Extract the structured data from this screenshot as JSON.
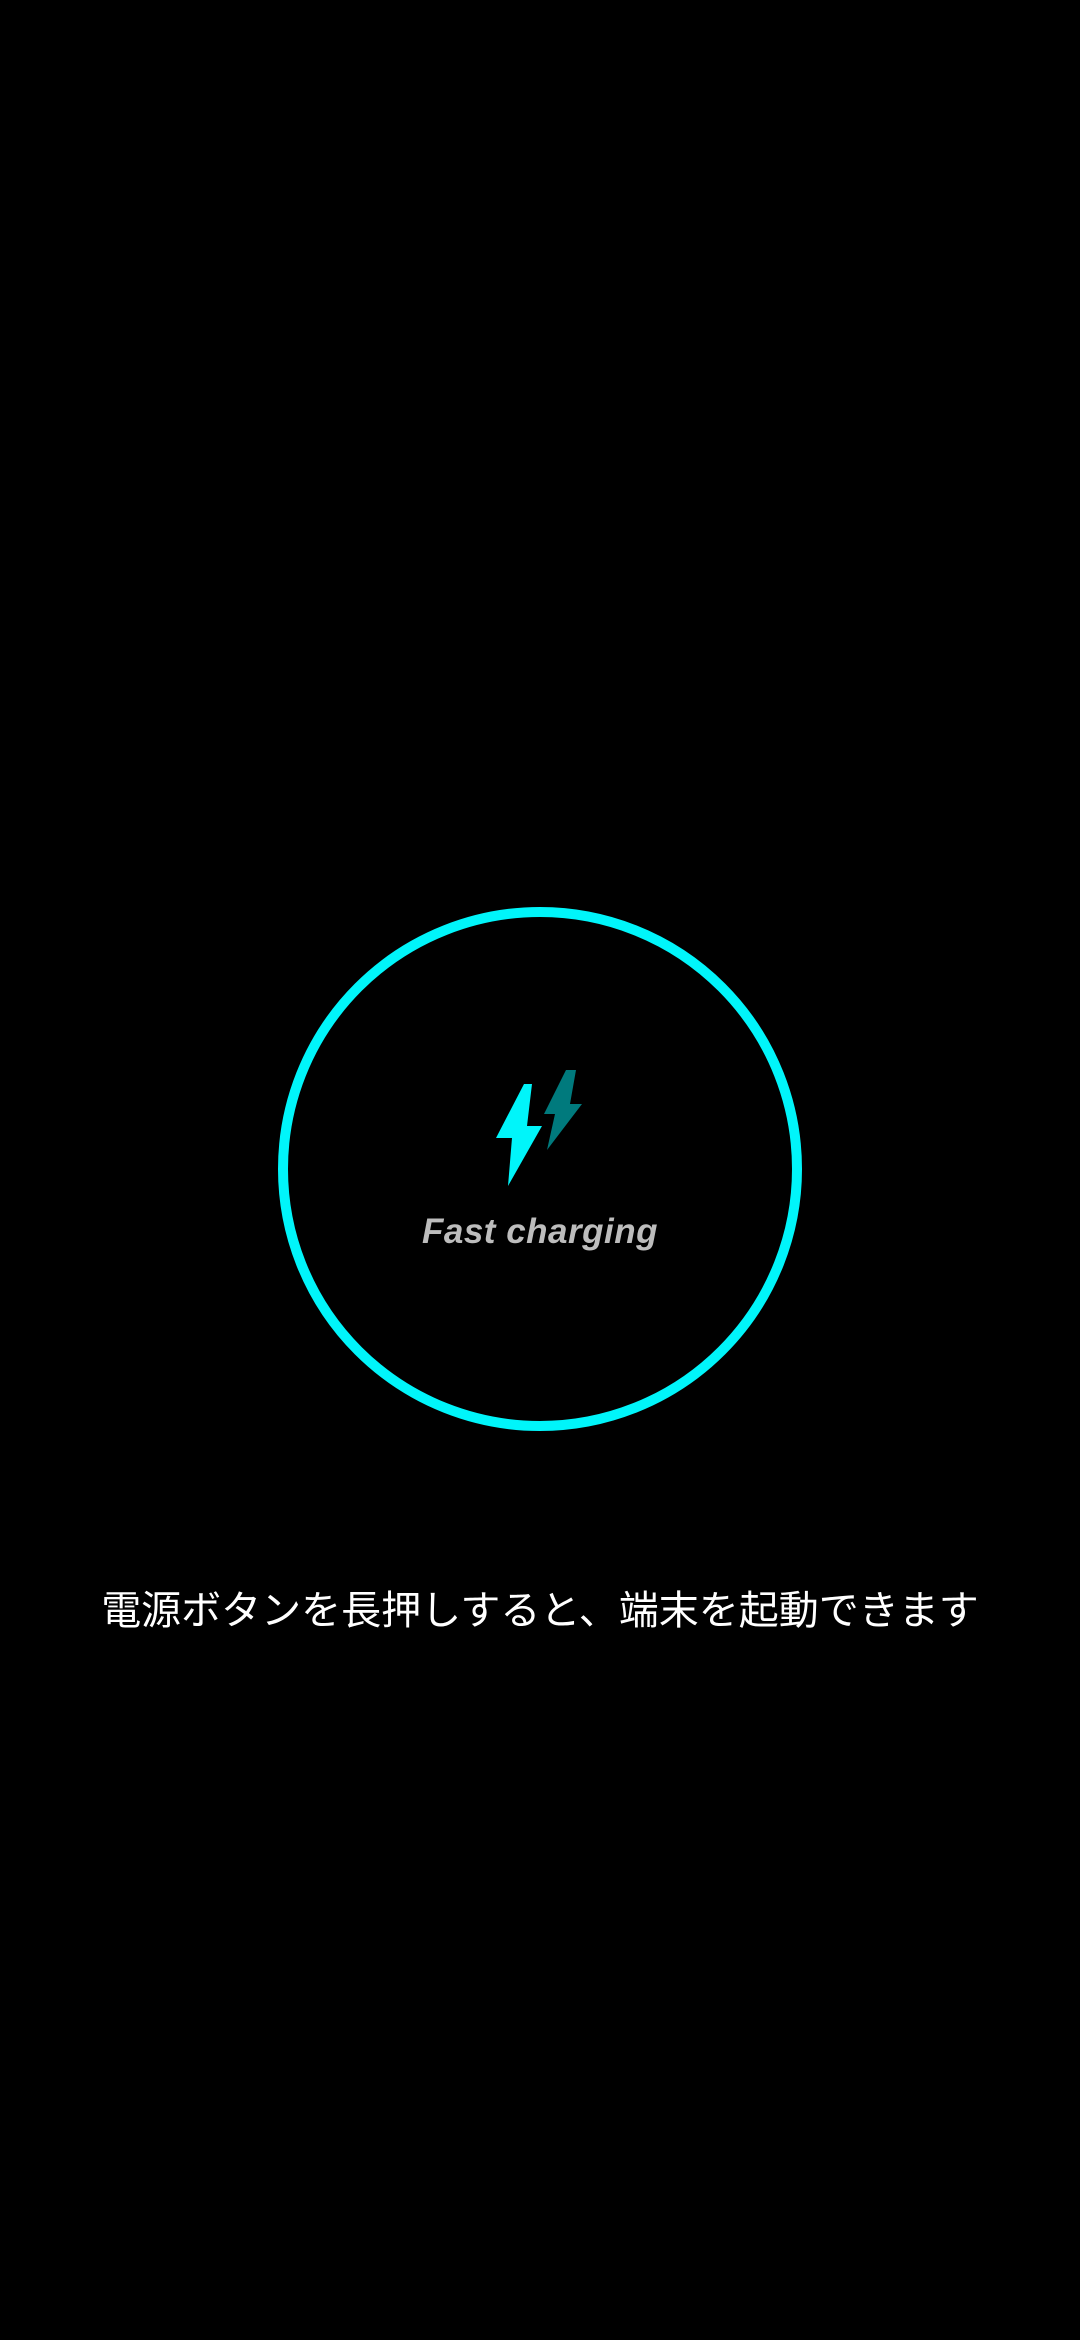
{
  "charging": {
    "status_label": "Fast charging",
    "icon": "double-lightning-bolt-icon",
    "ring_color": "#00F5FA",
    "bolt_primary_color": "#00F5FA",
    "bolt_secondary_color": "#007A7D"
  },
  "hint": {
    "text": "電源ボタンを長押しすると、端末を起動できます"
  }
}
